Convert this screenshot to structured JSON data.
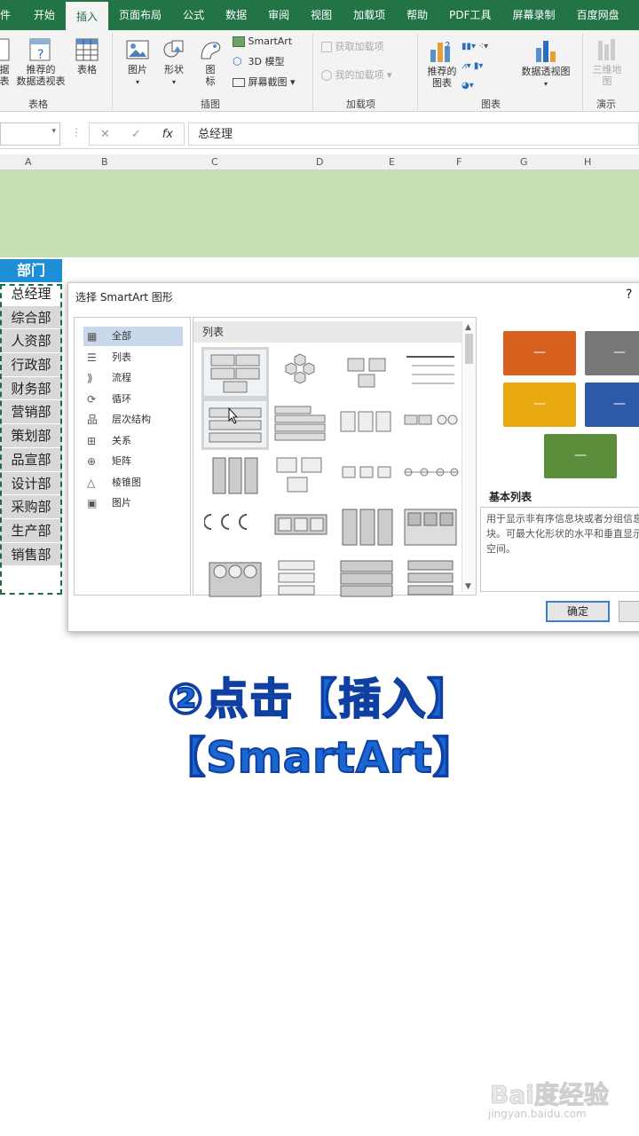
{
  "ribbon_tabs": [
    "件",
    "开始",
    "插入",
    "页面布局",
    "公式",
    "数据",
    "审阅",
    "视图",
    "加载项",
    "帮助",
    "PDF工具",
    "屏幕录制",
    "百度网盘"
  ],
  "active_tab_index": 2,
  "ribbon": {
    "table_group": {
      "b1": "据\n表",
      "b2": "推荐的\n数据透视表",
      "b3": "表格",
      "label": "表格"
    },
    "illus_group": {
      "pictures": "图片",
      "shapes": "形状",
      "icons": "图\n标",
      "smartart": "SmartArt",
      "model3d": "3D 模型",
      "screenshot": "屏幕截图",
      "label": "插图"
    },
    "addins_group": {
      "get": "获取加载项",
      "my": "我的加载项",
      "label": "加载项"
    },
    "charts_group": {
      "recommended": "推荐的\n图表",
      "pivotchart": "数据透视图",
      "label": "图表"
    },
    "tours_group": {
      "map3d": "三维地\n图",
      "label": "演示"
    }
  },
  "formula_bar": {
    "cancel": "✕",
    "enter": "✓",
    "fx": "fx",
    "content": "总经理"
  },
  "columns": [
    "A",
    "B",
    "C",
    "D",
    "E",
    "F",
    "G",
    "H"
  ],
  "sheet": {
    "header": "部门",
    "departments": [
      "总经理",
      "综合部",
      "人资部",
      "行政部",
      "财务部",
      "营销部",
      "策划部",
      "品宣部",
      "设计部",
      "采购部",
      "生产部",
      "销售部"
    ]
  },
  "dialog": {
    "title": "选择 SmartArt 图形",
    "help": "?",
    "categories": [
      "全部",
      "列表",
      "流程",
      "循环",
      "层次结构",
      "关系",
      "矩阵",
      "棱锥图",
      "图片"
    ],
    "selected_category_index": 0,
    "section_label": "列表",
    "preview_name": "基本列表",
    "preview_desc": "用于显示非有序信息块或者分组信息块。可最大化形状的水平和垂直显示空间。",
    "preview_box_text": "—",
    "ok_label": "确定",
    "colors": {
      "orange": "#d8601e",
      "gray": "#777777",
      "yellow": "#e8aa10",
      "blue": "#2c5aa8",
      "green": "#5a8e3a"
    }
  },
  "caption": {
    "line1": "②点击【插入】",
    "line2": "【SmartArt】"
  },
  "watermark": {
    "logo": "Bai度经验",
    "url": "jingyan.baidu.com"
  }
}
